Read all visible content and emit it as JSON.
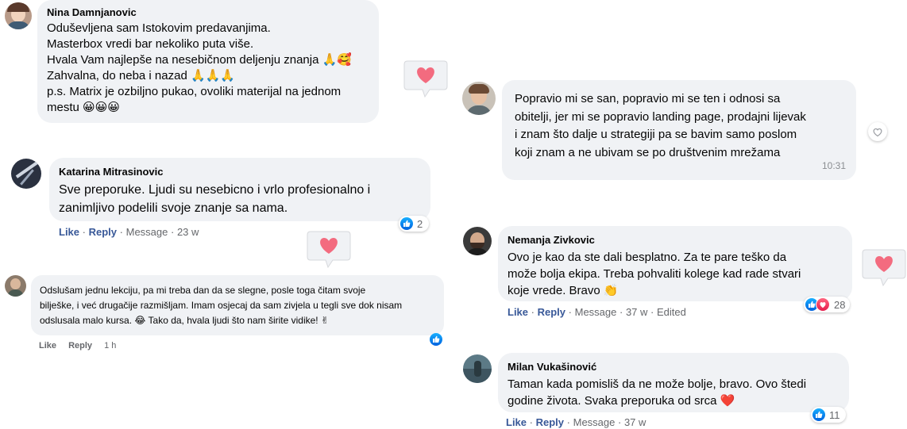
{
  "comments": [
    {
      "name": "Nina Damnjanovic",
      "text": "Oduševljena sam Istokovim predavanjima.\nMasterbox vredi bar nekoliko puta više.\nHvala Vam najlepše na nesebičnom deljenju znanja 🙏🥰\nZahvalna, do neba i nazad 🙏🙏🙏\np.s. Matrix je ozbiljno pukao, ovoliki materijal na jednom\nmestu 😀😀😀"
    },
    {
      "name": "Katarina Mitrasinovic",
      "text": "Sve preporuke. Ljudi su nesebicno i vrlo profesionalno i\nzanimljivo podelili svoje znanje sa nama.",
      "actions": {
        "like": "Like",
        "reply": "Reply",
        "message": "Message",
        "time": "23 w"
      },
      "reaction_count": "2"
    },
    {
      "name": "",
      "text": "Odslušam jednu lekciju, pa mi treba dan da se slegne, posle toga čitam svoje\nbilješke, i već drugačije razmišljam. Imam osjecaj da sam zivjela u tegli sve dok nisam\nodslusala malo kursa. 😂 Tako da, hvala ljudi što nam širite vidike! ✌",
      "actions": {
        "like": "Like",
        "reply": "Reply",
        "time": "1 h"
      }
    },
    {
      "name": "",
      "text": "Popravio mi se san, popravio mi se ten i odnosi sa\nobitelji, jer mi se popravio landing page, prodajni lijevak\ni znam što dalje u strategiji pa se bavim samo poslom\nkoji znam a ne ubivam se po društvenim mrežama",
      "time": "10:31"
    },
    {
      "name": "Nemanja Zivkovic",
      "text": "Ovo je kao da ste dali besplatno. Za te pare teško da\nmože bolja ekipa. Treba pohvaliti kolege kad rade stvari\nkoje vrede. Bravo 👏",
      "actions": {
        "like": "Like",
        "reply": "Reply",
        "message": "Message",
        "time": "37 w",
        "edited": "Edited"
      },
      "reaction_count": "28"
    },
    {
      "name": "Milan Vukašinović",
      "text": "Taman kada pomisliš da ne može bolje, bravo. Ovo štedi\ngodine života. Svaka preporuka od srca ❤️",
      "actions": {
        "like": "Like",
        "reply": "Reply",
        "message": "Message",
        "time": "37 w"
      },
      "reaction_count": "11"
    }
  ],
  "separator": "·",
  "colors": {
    "bubble": "#f0f2f5",
    "link": "#385898",
    "meta": "#65676b",
    "like": "#0571ed",
    "love": "#f33e58"
  },
  "icons": [
    "heart-sticker-icon",
    "like-icon",
    "love-icon",
    "heart-outline-icon"
  ]
}
